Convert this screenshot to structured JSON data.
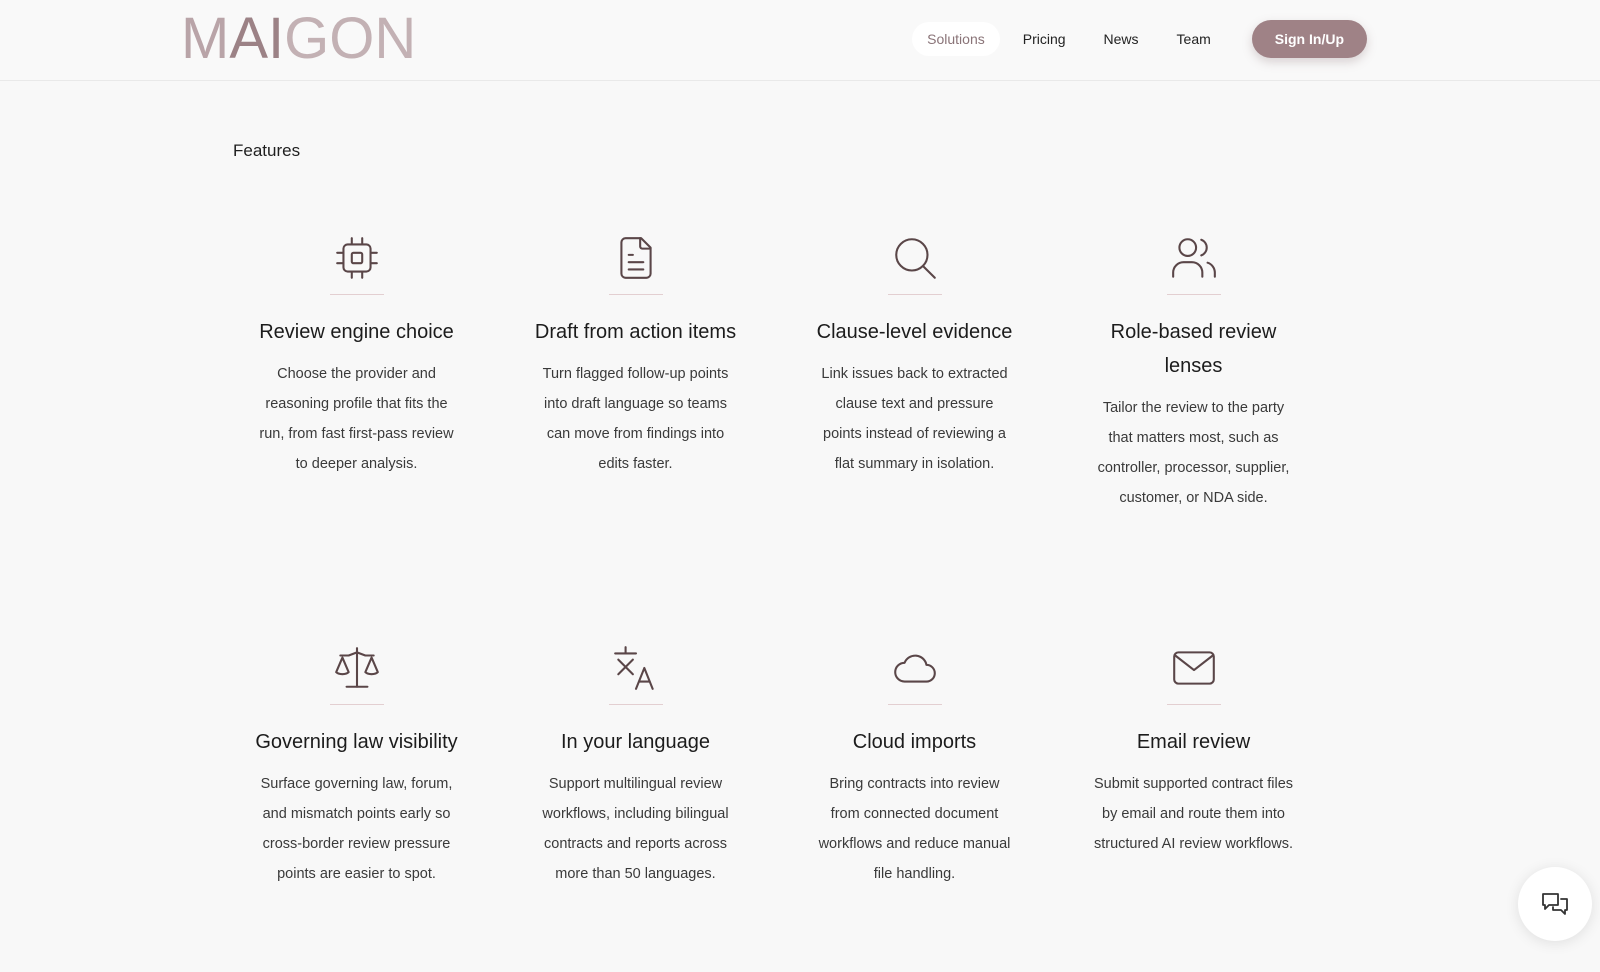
{
  "header": {
    "logo": {
      "part1": "M",
      "part2": "AI",
      "part3": "GON"
    },
    "nav": [
      {
        "label": "Solutions",
        "active": true
      },
      {
        "label": "Pricing",
        "active": false
      },
      {
        "label": "News",
        "active": false
      },
      {
        "label": "Team",
        "active": false
      }
    ],
    "signin_label": "Sign In/Up"
  },
  "section": {
    "label": "Features"
  },
  "features": [
    {
      "icon": "cpu-chip-icon",
      "title": "Review engine choice",
      "desc": "Choose the provider and reasoning profile that fits the run, from fast first-pass review to deeper analysis."
    },
    {
      "icon": "document-icon",
      "title": "Draft from action items",
      "desc": "Turn flagged follow-up points into draft language so teams can move from findings into edits faster."
    },
    {
      "icon": "search-icon",
      "title": "Clause-level evidence",
      "desc": "Link issues back to extracted clause text and pressure points instead of reviewing a flat summary in isolation."
    },
    {
      "icon": "users-icon",
      "title": "Role-based review lenses",
      "desc": "Tailor the review to the party that matters most, such as controller, processor, supplier, customer, or NDA side."
    },
    {
      "icon": "scale-icon",
      "title": "Governing law visibility",
      "desc": "Surface governing law, forum, and mismatch points early so cross-border review pressure points are easier to spot."
    },
    {
      "icon": "translate-icon",
      "title": "In your language",
      "desc": "Support multilingual review workflows, including bilingual contracts and reports across more than 50 languages."
    },
    {
      "icon": "cloud-icon",
      "title": "Cloud imports",
      "desc": "Bring contracts into review from connected document workflows and reduce manual file handling."
    },
    {
      "icon": "mail-icon",
      "title": "Email review",
      "desc": "Submit supported contract files by email and route them into structured AI review workflows."
    }
  ],
  "chat": {
    "icon": "chat-icon"
  },
  "colors": {
    "accent": "#9f8286",
    "icon_stroke": "#5a4648",
    "background": "#f8f8f8"
  }
}
